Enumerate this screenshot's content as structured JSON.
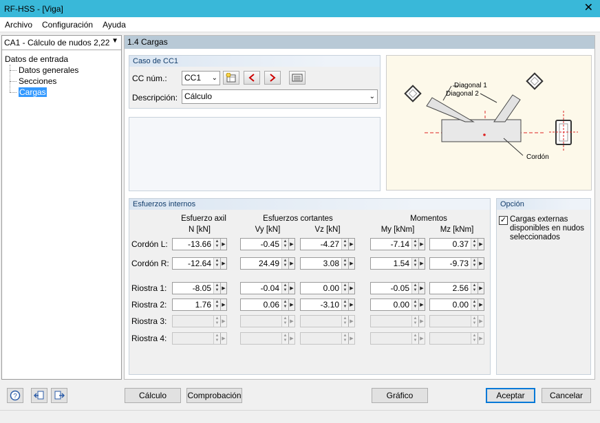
{
  "window": {
    "title": "RF-HSS - [Viga]"
  },
  "menu": [
    "Archivo",
    "Configuración",
    "Ayuda"
  ],
  "case_selector": "CA1 - Cálculo de nudos 2,22",
  "tree": {
    "root": "Datos de entrada",
    "children": [
      "Datos generales",
      "Secciones",
      "Cargas"
    ],
    "selected": "Cargas"
  },
  "section_title": "1.4 Cargas",
  "caso": {
    "group_label": "Caso de CC1",
    "cc_label": "CC núm.:",
    "cc_value": "CC1",
    "desc_label": "Descripción:",
    "desc_value": "Cálculo"
  },
  "diagram": {
    "diagonal1": "Diagonal 1",
    "diagonal2": "Diagonal 2",
    "cordon": "Cordón"
  },
  "esfuerzos": {
    "group_label": "Esfuerzos internos",
    "groups": {
      "axil": "Esfuerzo axil",
      "cortantes": "Esfuerzos cortantes",
      "momentos": "Momentos"
    },
    "columns": [
      "N [kN]",
      "Vy [kN]",
      "Vz [kN]",
      "My [kNm]",
      "Mz [kNm]"
    ],
    "rows": [
      {
        "label": "Cordón L:",
        "values": [
          "-13.66",
          "-0.45",
          "-4.27",
          "-7.14",
          "0.37"
        ]
      },
      {
        "label": "Cordón R:",
        "values": [
          "-12.64",
          "24.49",
          "3.08",
          "1.54",
          "-9.73"
        ]
      },
      {
        "label": "Riostra 1:",
        "values": [
          "-8.05",
          "-0.04",
          "0.00",
          "-0.05",
          "2.56"
        ]
      },
      {
        "label": "Riostra 2:",
        "values": [
          "1.76",
          "0.06",
          "-3.10",
          "0.00",
          "0.00"
        ]
      },
      {
        "label": "Riostra 3:",
        "values": [
          "",
          "",
          "",
          "",
          ""
        ]
      },
      {
        "label": "Riostra 4:",
        "values": [
          "",
          "",
          "",
          "",
          ""
        ]
      }
    ]
  },
  "opcion": {
    "group_label": "Opción",
    "checkbox_label": "Cargas externas disponibles en nudos seleccionados",
    "checked": true
  },
  "buttons": {
    "calculo": "Cálculo",
    "comprobacion": "Comprobación",
    "grafico": "Gráfico",
    "aceptar": "Aceptar",
    "cancelar": "Cancelar"
  }
}
